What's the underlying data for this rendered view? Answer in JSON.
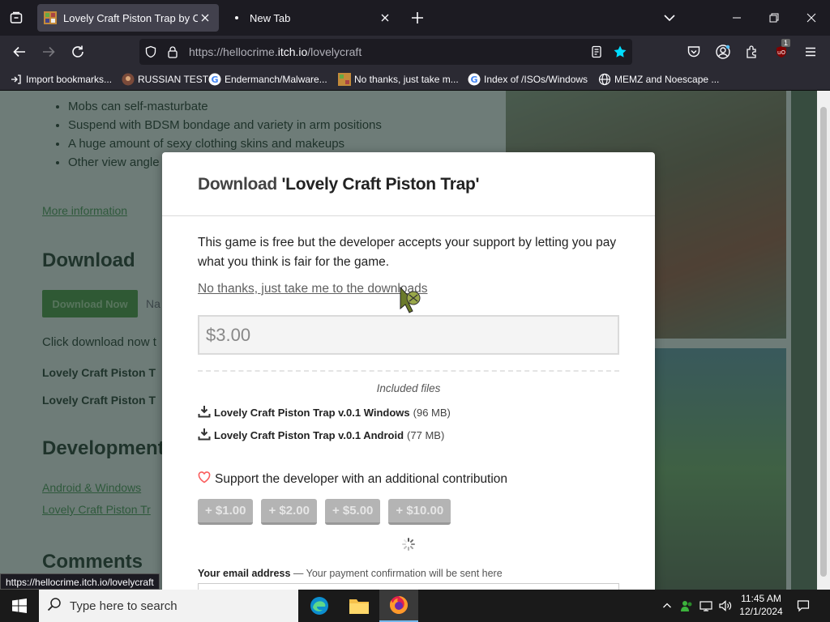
{
  "browser": {
    "tabs": [
      {
        "title": "Lovely Craft Piston Trap by Crim",
        "active": true
      },
      {
        "title": "New Tab",
        "active": false
      }
    ],
    "url_prefix": "https://hellocrime.",
    "url_domain": "itch.io",
    "url_path": "/lovelycraft",
    "bookmarks": [
      {
        "label": "Import bookmarks...",
        "icon": "import-icon"
      },
      {
        "label": "RUSSIAN TEST",
        "icon": "user-icon"
      },
      {
        "label": "Endermanch/Malware...",
        "icon": "google-icon"
      },
      {
        "label": "No thanks, just take m...",
        "icon": "itch-icon"
      },
      {
        "label": "Index of /ISOs/Windows",
        "icon": "google-icon"
      },
      {
        "label": "MEMZ and Noescape ...",
        "icon": "globe-icon"
      }
    ],
    "extension_badge": "1",
    "status_url": "https://hellocrime.itch.io/lovelycraft"
  },
  "background_page": {
    "bullets": [
      "Mobs can self-masturbate",
      "Suspend with BDSM bondage and variety in arm positions",
      "A huge amount of sexy clothing skins and makeups",
      "Other view angle"
    ],
    "more_info": "More information",
    "download_heading": "Download",
    "download_button": "Download Now",
    "download_button_sub": "Na",
    "click_download": "Click download now t",
    "file1": "Lovely Craft Piston T",
    "file2": "Lovely Craft Piston T",
    "development_heading": "Development",
    "devlog1": "Android & Windows",
    "devlog2": "Lovely Craft Piston Tr",
    "comments_heading": "Comments"
  },
  "modal": {
    "title_prefix": "Download ",
    "title_game": "'Lovely Craft Piston Trap'",
    "intro": "This game is free but the developer accepts your support by letting you pay what you think is fair for the game.",
    "no_thanks": "No thanks, just take me to the downloads",
    "price_value": "$3.00",
    "included_files": "Included files",
    "files": [
      {
        "name": "Lovely Craft Piston Trap v.0.1 Windows",
        "size": "(96 MB)"
      },
      {
        "name": "Lovely Craft Piston Trap v.0.1 Android",
        "size": "(77 MB)"
      }
    ],
    "support": "Support the developer with an additional contribution",
    "amounts": [
      "+ $1.00",
      "+ $2.00",
      "+ $5.00",
      "+ $10.00"
    ],
    "email_label": "Your email address",
    "email_note": " — Your payment confirmation will be sent here"
  },
  "taskbar": {
    "search_placeholder": "Type here to search",
    "time": "11:45 AM",
    "date": "12/1/2024"
  },
  "colors": {
    "accent": "#fa5c5c",
    "star": "#54ffbd"
  }
}
